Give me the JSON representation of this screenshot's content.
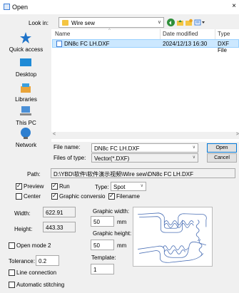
{
  "window": {
    "title": "Open",
    "close_glyph": "×"
  },
  "lookin": {
    "label": "Look in:",
    "value": "Wire sew"
  },
  "places": [
    {
      "label": "Quick access",
      "icon": "star-icon"
    },
    {
      "label": "Desktop",
      "icon": "desktop-icon"
    },
    {
      "label": "Libraries",
      "icon": "libraries-icon"
    },
    {
      "label": "This PC",
      "icon": "computer-icon"
    },
    {
      "label": "Network",
      "icon": "network-icon"
    }
  ],
  "filelist": {
    "columns": [
      "Name",
      "Date modified",
      "Type"
    ],
    "rows": [
      {
        "name": "DN8c FC LH.DXF",
        "date": "2024/12/13 16:30",
        "type": "DXF File"
      }
    ]
  },
  "file_name": {
    "label": "File name:",
    "value": "DN8c FC LH.DXF"
  },
  "file_type": {
    "label": "Files of type:",
    "value": "Vector(*.DXF)"
  },
  "buttons": {
    "open": "Open",
    "cancel": "Cancel"
  },
  "path": {
    "label": "Path:",
    "value": "D:\\YBD\\软件\\软件演示视频\\Wire sew\\DN8c FC LH.DXF"
  },
  "options": {
    "preview": {
      "label": "Preview",
      "checked": true
    },
    "run": {
      "label": "Run",
      "checked": true
    },
    "type_label": "Type:",
    "type_value": "Spot",
    "center": {
      "label": "Center",
      "checked": false
    },
    "graphic_conversion": {
      "label": "Graphic conversio",
      "checked": true
    },
    "filename": {
      "label": "Filename",
      "checked": true
    }
  },
  "dimensions": {
    "width_label": "Width:",
    "width_value": "622.91",
    "height_label": "Height:",
    "height_value": "443.33",
    "graphic_width_label": "Graphic width:",
    "graphic_width_value": "50",
    "graphic_width_unit": "mm",
    "graphic_height_label": "Graphic height:",
    "graphic_height_value": "50",
    "graphic_height_unit": "mm"
  },
  "open_mode2": {
    "label": "Open mode 2",
    "checked": false
  },
  "tolerance": {
    "label": "Tolerance:",
    "value": "0.2"
  },
  "template": {
    "label": "Template:",
    "value": "1"
  },
  "line_connection": {
    "label": "Line connection",
    "checked": false
  },
  "automatic_stitching": {
    "label": "Automatic stitching",
    "checked": false
  },
  "colors": {
    "selection": "#cce8ff",
    "preview_stroke": "#4a6fb5",
    "accent": "#0078d7"
  }
}
